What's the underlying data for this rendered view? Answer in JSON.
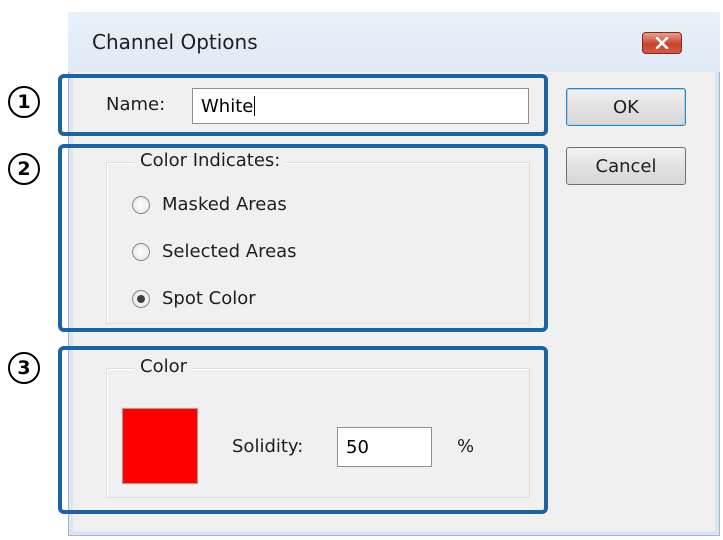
{
  "dialog": {
    "title": "Channel Options",
    "close_icon": "close-icon",
    "name_label": "Name:",
    "name_value": "White",
    "ok_label": "OK",
    "cancel_label": "Cancel",
    "color_indicates": {
      "legend": "Color Indicates:",
      "options": [
        {
          "label": "Masked Areas",
          "selected": false
        },
        {
          "label": "Selected Areas",
          "selected": false
        },
        {
          "label": "Spot Color",
          "selected": true
        }
      ]
    },
    "color_group": {
      "legend": "Color",
      "swatch_color": "#ff0000",
      "solidity_label": "Solidity:",
      "solidity_value": "50",
      "unit": "%"
    }
  },
  "callouts": [
    "1",
    "2",
    "3"
  ],
  "accent_color": "#1e62a0"
}
